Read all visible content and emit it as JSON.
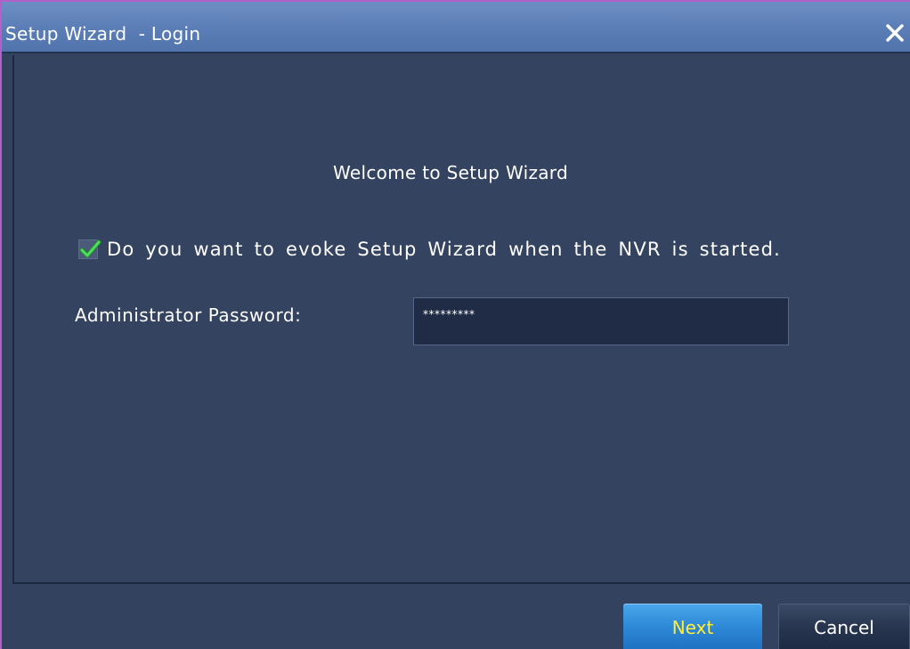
{
  "window": {
    "title": "Setup Wizard  - Login"
  },
  "icons": {
    "close": "close-icon",
    "check": "checkmark-icon"
  },
  "content": {
    "welcome": "Welcome to Setup Wizard",
    "evoke_checkbox": {
      "label": "Do you want to evoke Setup Wizard when the NVR is started.",
      "checked": true
    },
    "password": {
      "label": "Administrator Password:",
      "value": "*********"
    }
  },
  "footer": {
    "next_label": "Next",
    "cancel_label": "Cancel"
  },
  "colors": {
    "accent": "#2f8ad8",
    "next_text": "#ffef3a",
    "check_green": "#37c24a",
    "titlebar": "#5b7db6",
    "background": "#34435f"
  }
}
